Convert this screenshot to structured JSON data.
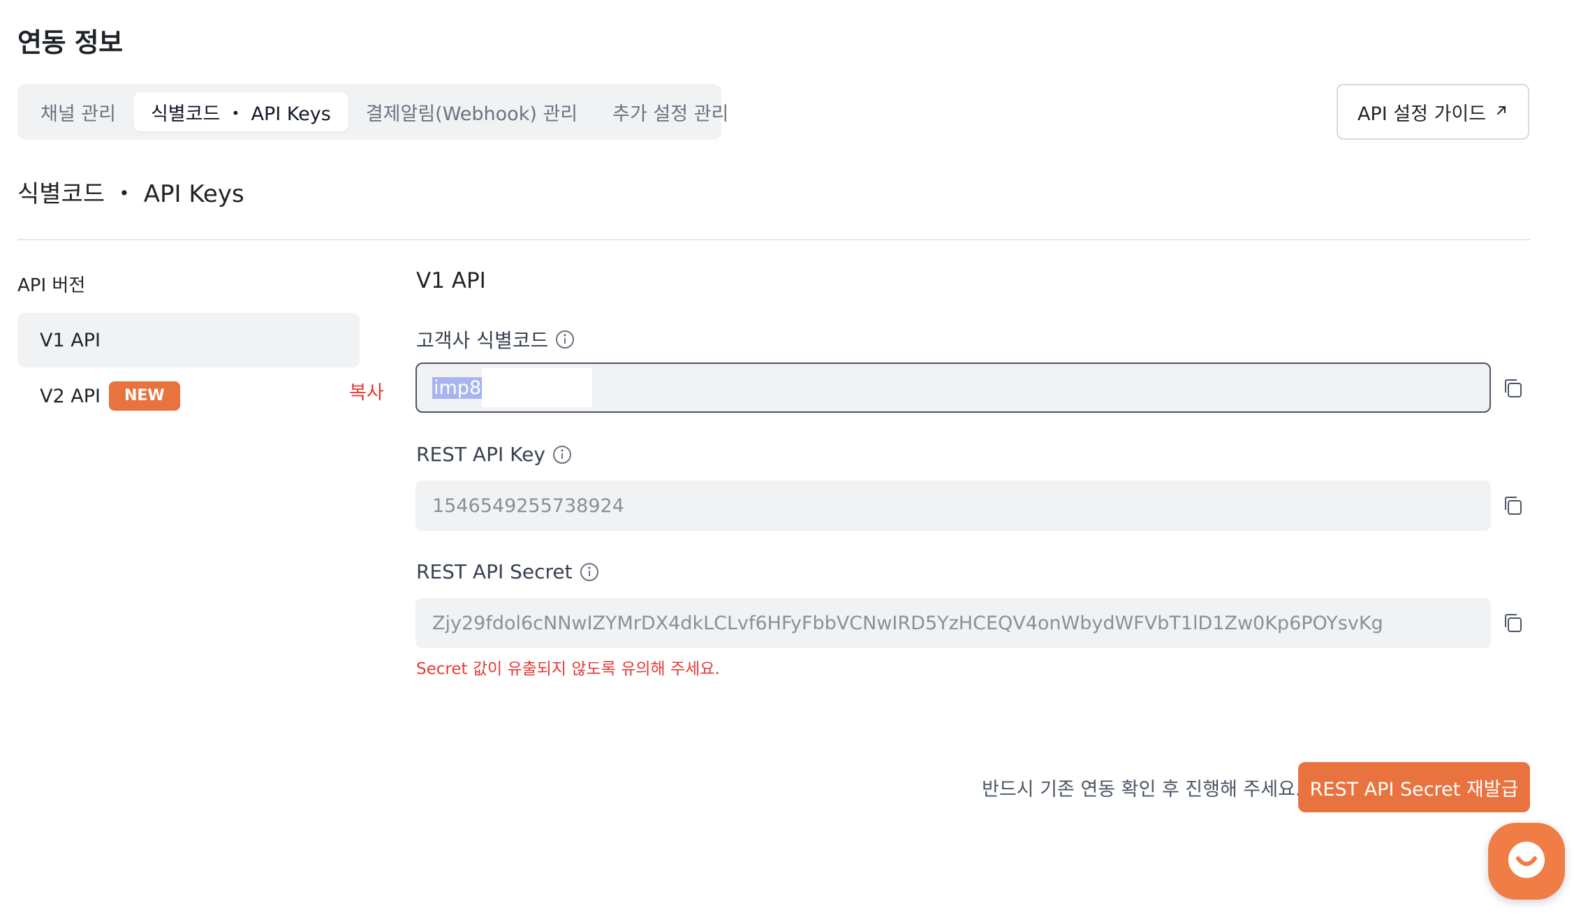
{
  "page": {
    "title": "연동 정보"
  },
  "tabs": [
    {
      "label": "채널 관리",
      "active": false
    },
    {
      "label": "식별코드 ・ API Keys",
      "active": true
    },
    {
      "label": "결제알림(Webhook) 관리",
      "active": false
    },
    {
      "label": "추가 설정 관리",
      "active": false
    }
  ],
  "guide_button": {
    "label": "API 설정 가이드",
    "icon": "external-arrow-icon"
  },
  "section": {
    "title": "식별코드 ・ API Keys"
  },
  "sidebar": {
    "heading": "API 버전",
    "items": [
      {
        "label": "V1 API",
        "active": true
      },
      {
        "label": "V2 API",
        "badge": "NEW",
        "active": false
      }
    ]
  },
  "copy_tooltip": "복사",
  "main": {
    "heading": "V1 API",
    "fields": [
      {
        "label": "고객사 식별코드",
        "value": "imp8",
        "info_icon": "info-icon",
        "copy_icon": "copy-icon"
      },
      {
        "label": "REST API Key",
        "value": "1546549255738924",
        "info_icon": "info-icon",
        "copy_icon": "copy-icon"
      },
      {
        "label": "REST API Secret",
        "value": "Zjy29fdol6cNNwIZYMrDX4dkLCLvf6HFyFbbVCNwIRD5YzHCEQV4onWbydWFVbT1lD1Zw0Kp6POYsvKg",
        "info_icon": "info-icon",
        "copy_icon": "copy-icon"
      }
    ],
    "warning": "Secret 값이 유출되지 않도록 유의해 주세요."
  },
  "footer": {
    "note": "반드시 기존 연동 확인 후 진행해 주세요.",
    "reissue_button": "REST API Secret 재발급"
  },
  "colors": {
    "accent": "#e9733e",
    "warning": "#e53935",
    "field_bg": "#f1f2f4"
  },
  "chat_button": {
    "icon": "chat-icon"
  }
}
